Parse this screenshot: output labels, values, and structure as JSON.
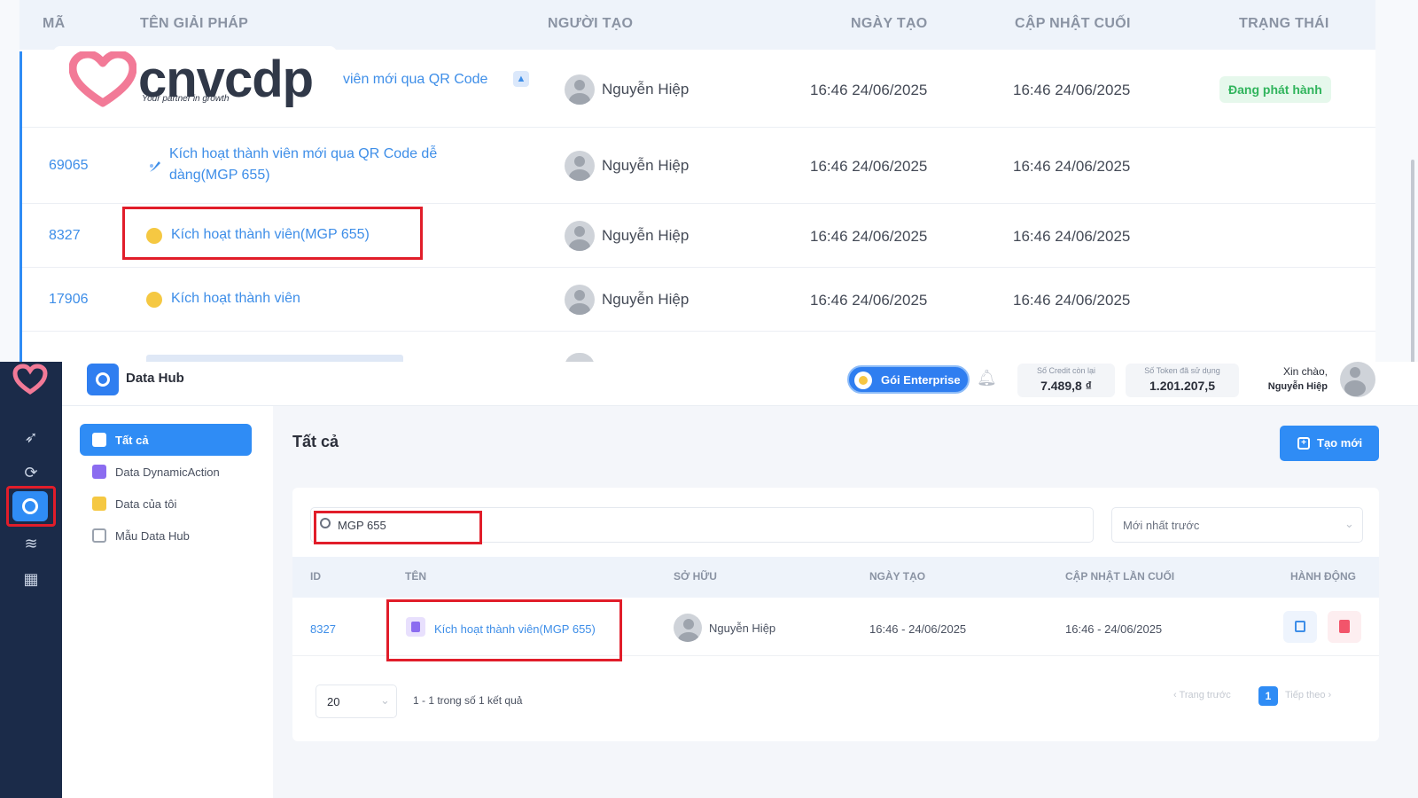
{
  "top_table": {
    "headers": [
      "MÃ",
      "TÊN GIẢI PHÁP",
      "NGƯỜI TẠO",
      "NGÀY TẠO",
      "CẬP NHẬT CUỐI",
      "TRẠNG THÁI"
    ],
    "rows": [
      {
        "id": "",
        "name": "viên mới qua QR Code",
        "creator": "Nguyễn Hiệp",
        "created": "16:46 24/06/2025",
        "updated": "16:46 24/06/2025",
        "status": "Đang phát hành"
      },
      {
        "id": "69065",
        "name_line1": "Kích hoạt thành viên mới qua QR Code dễ",
        "name_line2": "dàng(MGP 655)",
        "creator": "Nguyễn Hiệp",
        "created": "16:46 24/06/2025",
        "updated": "16:46 24/06/2025",
        "status": ""
      },
      {
        "id": "8327",
        "name": "Kích hoạt thành viên(MGP 655)",
        "creator": "Nguyễn Hiệp",
        "created": "16:46 24/06/2025",
        "updated": "16:46 24/06/2025",
        "status": ""
      },
      {
        "id": "17906",
        "name": "Kích hoạt thành viên",
        "creator": "Nguyễn Hiệp",
        "created": "16:46 24/06/2025",
        "updated": "16:46 24/06/2025",
        "status": ""
      }
    ]
  },
  "logo": {
    "word": "cnvcdp",
    "tagline": "Your partner in growth"
  },
  "header": {
    "app_title": "Data Hub",
    "plan_label": "Gói Enterprise",
    "credit_label": "Số Credit còn lại",
    "credit_value": "7.489,8 ₫",
    "token_label": "Số Token đã sử dụng",
    "token_value": "1.201.207,5",
    "greeting": "Xin chào,",
    "user_name": "Nguyễn Hiệp"
  },
  "sidebar": {
    "items": [
      {
        "label": "Tất cả",
        "icon": "grid-icon",
        "color": "#ffffff"
      },
      {
        "label": "Data DynamicAction",
        "icon": "document-icon",
        "color": "#8b6cf0"
      },
      {
        "label": "Data của tôi",
        "icon": "folder-icon",
        "color": "#f5c842"
      },
      {
        "label": "Mẫu Data Hub",
        "icon": "template-icon",
        "color": "#8a93a3"
      }
    ]
  },
  "main": {
    "title": "Tất cả",
    "create_button": "Tạo mới",
    "search_value": "MGP 655",
    "sort_value": "Mới nhất trước",
    "table_headers": {
      "id": "ID",
      "name": "TÊN",
      "owner": "SỞ HỮU",
      "created": "NGÀY TẠO",
      "updated": "CẬP NHẬT LẦN CUỐI",
      "actions": "HÀNH ĐỘNG"
    },
    "row": {
      "id": "8327",
      "name": "Kích hoạt thành viên(MGP 655)",
      "owner": "Nguyễn Hiệp",
      "created": "16:46 - 24/06/2025",
      "updated": "16:46 - 24/06/2025"
    },
    "page_size": "20",
    "result_text": "1 - 1 trong số 1 kết quả",
    "prev_label": "Trang trước",
    "next_label": "Tiếp theo",
    "current_page": "1"
  },
  "colors": {
    "accent": "#2f8cf5",
    "rail": "#1b2b49",
    "highlight": "#e11d2a",
    "status_green": "#30b45c",
    "brand_pink": "#f06b8a"
  }
}
